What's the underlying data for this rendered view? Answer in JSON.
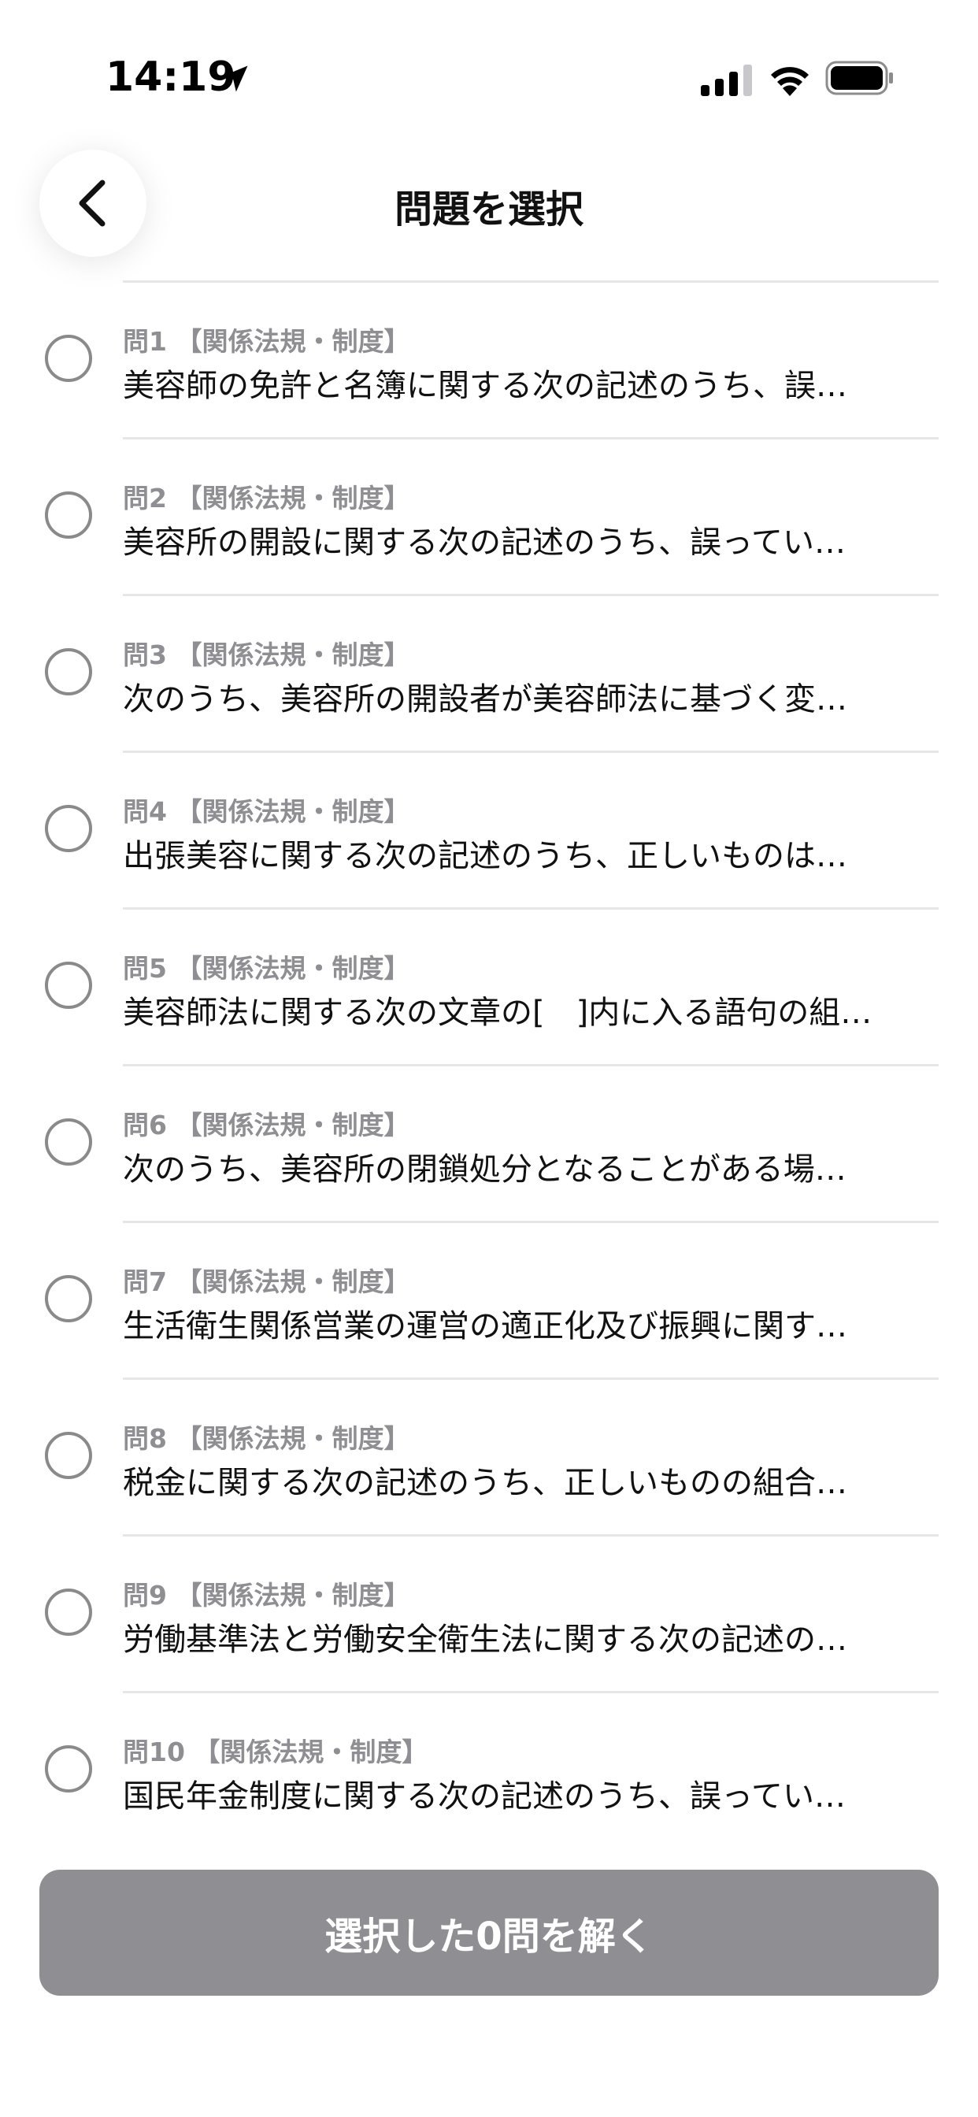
{
  "status_bar": {
    "time": "14:19",
    "icons": [
      "location-arrow-icon",
      "cellular-signal-icon",
      "wifi-icon",
      "battery-icon"
    ]
  },
  "nav": {
    "title": "問題を選択",
    "back_icon": "chevron-left-icon"
  },
  "questions": [
    {
      "meta": "問1 【関係法規・制度】",
      "text": "美容師の免許と名簿に関する次の記述のうち、誤…",
      "selected": false
    },
    {
      "meta": "問2 【関係法規・制度】",
      "text": "美容所の開設に関する次の記述のうち、誤ってい…",
      "selected": false
    },
    {
      "meta": "問3 【関係法規・制度】",
      "text": "次のうち、美容所の開設者が美容師法に基づく変…",
      "selected": false
    },
    {
      "meta": "問4 【関係法規・制度】",
      "text": "出張美容に関する次の記述のうち、正しいものは…",
      "selected": false
    },
    {
      "meta": "問5 【関係法規・制度】",
      "text": "美容師法に関する次の文章の[　]内に入る語句の組…",
      "selected": false
    },
    {
      "meta": "問6 【関係法規・制度】",
      "text": "次のうち、美容所の閉鎖処分となることがある場…",
      "selected": false
    },
    {
      "meta": "問7 【関係法規・制度】",
      "text": "生活衛生関係営業の運営の適正化及び振興に関す…",
      "selected": false
    },
    {
      "meta": "問8 【関係法規・制度】",
      "text": "税金に関する次の記述のうち、正しいものの組合…",
      "selected": false
    },
    {
      "meta": "問9 【関係法規・制度】",
      "text": "労働基準法と労働安全衛生法に関する次の記述の…",
      "selected": false
    },
    {
      "meta": "問10 【関係法規・制度】",
      "text": "国民年金制度に関する次の記述のうち、誤ってい…",
      "selected": false
    }
  ],
  "footer": {
    "solve_label": "選択した0問を解く",
    "button_color": "#8e8e93"
  }
}
